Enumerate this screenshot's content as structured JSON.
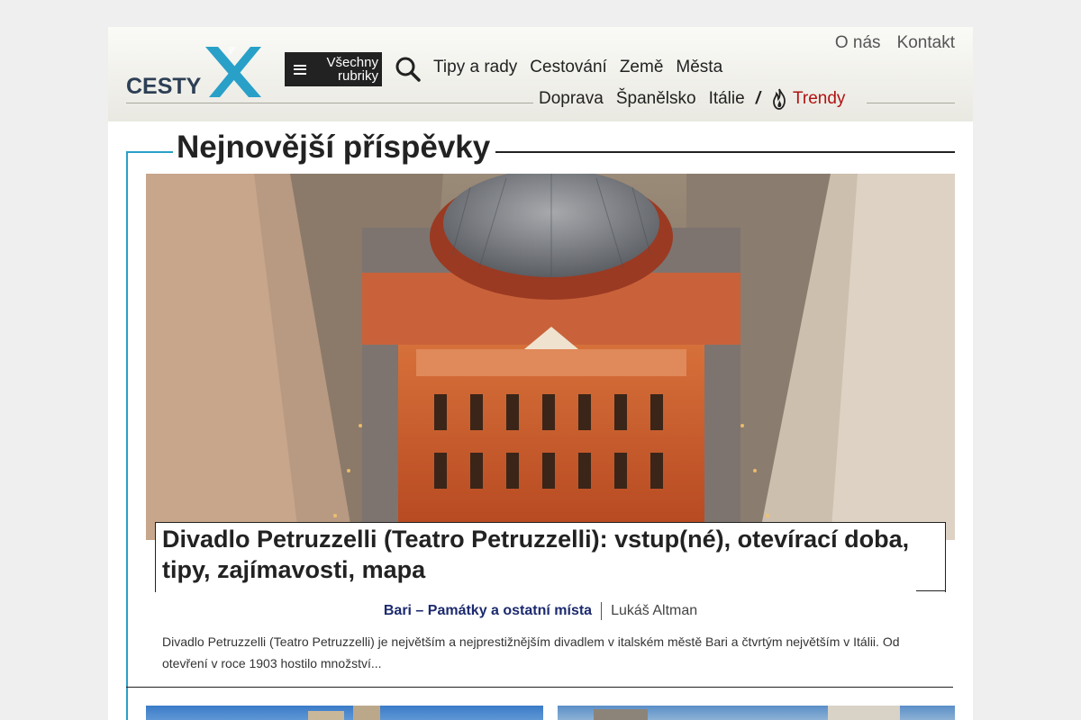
{
  "header": {
    "logo_text": "CESTY",
    "menu_button_label_1": "Všechny",
    "menu_button_label_2": "rubriky",
    "nav_primary": [
      "Tipy a rady",
      "Cestování",
      "Země",
      "Města"
    ],
    "nav_secondary": [
      "Doprava",
      "Španělsko",
      "Itálie"
    ],
    "nav_separator": "/",
    "trendy_label": "Trendy",
    "utility_links": [
      "O nás",
      "Kontakt"
    ]
  },
  "colors": {
    "accent": "#29a0c8",
    "trendy": "#b01212",
    "category_link": "#1c2a6e"
  },
  "main": {
    "section_title": "Nejnovější příspěvky",
    "featured": {
      "title": "Divadlo Petruzzelli (Teatro Petruzzelli): vstup(né), otevírací doba, tipy, zajímavosti, mapa",
      "category": "Bari – Památky a ostatní místa",
      "author": "Lukáš Altman",
      "excerpt": "Divadlo Petruzzelli (Teatro Petruzzelli) je největším a nejprestižnějším divadlem v italském městě Bari a čtvrtým největším v Itálii. Od otevření v roce 1903 hostilo množství..."
    }
  }
}
